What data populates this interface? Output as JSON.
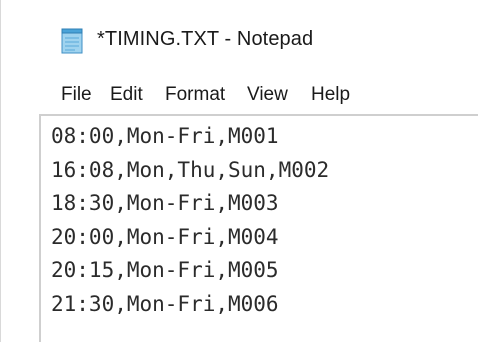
{
  "window": {
    "title": "*TIMING.TXT - Notepad",
    "app_icon": "notepad-icon"
  },
  "menu": {
    "items": [
      {
        "label": "File"
      },
      {
        "label": "Edit"
      },
      {
        "label": "Format"
      },
      {
        "label": "View"
      },
      {
        "label": "Help"
      }
    ]
  },
  "editor": {
    "lines": [
      "08:00,Mon-Fri,M001",
      "16:08,Mon,Thu,Sun,M002",
      "18:30,Mon-Fri,M003",
      "20:00,Mon-Fri,M004",
      "20:15,Mon-Fri,M005",
      "21:30,Mon-Fri,M006"
    ]
  },
  "colors": {
    "text": "#2b2b2b",
    "background": "#ffffff",
    "border": "#cfcfcf"
  }
}
